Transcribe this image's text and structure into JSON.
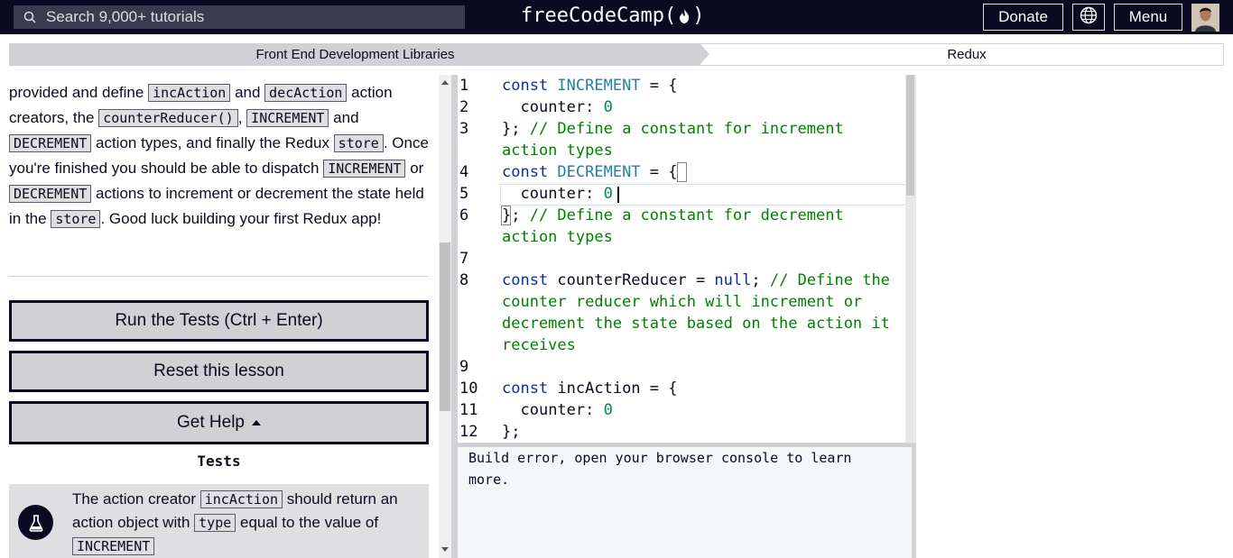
{
  "nav": {
    "search_placeholder": "Search 9,000+ tutorials",
    "logo_text_left": "freeCodeCamp(",
    "logo_text_right": ")",
    "donate_label": "Donate",
    "menu_label": "Menu"
  },
  "breadcrumb": {
    "superblock": "Front End Development Libraries",
    "block": "Redux"
  },
  "instructions": {
    "t1": "provided and define ",
    "c1": "incAction",
    "t2": " and ",
    "c2": "decAction",
    "t3": " action creators, the ",
    "c3": "counterReducer()",
    "t4": ", ",
    "c4": "INCREMENT",
    "t5": " and ",
    "c5": "DECREMENT",
    "t6": " action types, and finally the Redux ",
    "c6": "store",
    "t7": ". Once you're finished you should be able to dispatch ",
    "c7": "INCREMENT",
    "t8": " or ",
    "c8": "DECREMENT",
    "t9": " actions to increment or decrement the state held in the ",
    "c9": "store",
    "t10": ". Good luck building your first Redux app!"
  },
  "buttons": {
    "run": "Run the Tests (Ctrl + Enter)",
    "reset": "Reset this lesson",
    "help": "Get Help"
  },
  "tests": {
    "title": "Tests",
    "item1": {
      "t1": "The action creator ",
      "c1": "incAction",
      "t2": " should return an action object with ",
      "c2": "type",
      "t3": " equal to the value of ",
      "c3": "INCREMENT"
    }
  },
  "editor": {
    "lines": [
      {
        "n": "1",
        "parts": [
          [
            "kw",
            "const "
          ],
          [
            "const",
            "INCREMENT"
          ],
          [
            "plain",
            " = {"
          ]
        ]
      },
      {
        "n": "2",
        "parts": [
          [
            "plain",
            "  counter: "
          ],
          [
            "num",
            "0"
          ]
        ]
      },
      {
        "n": "3",
        "parts": [
          [
            "plain",
            "}; "
          ],
          [
            "cmt",
            "// Define a constant for increment action types"
          ]
        ]
      },
      {
        "n": "4",
        "parts": [
          [
            "kw",
            "const "
          ],
          [
            "const",
            "DECREMENT"
          ],
          [
            "plain",
            " = {"
          ]
        ]
      },
      {
        "n": "5",
        "parts": [
          [
            "plain",
            "  counter: "
          ],
          [
            "num",
            "0"
          ]
        ]
      },
      {
        "n": "6",
        "parts": [
          [
            "plain",
            "}; "
          ],
          [
            "cmt",
            "// Define a constant for decrement action types"
          ]
        ]
      },
      {
        "n": "7",
        "parts": [
          [
            "plain",
            ""
          ]
        ]
      },
      {
        "n": "8",
        "parts": [
          [
            "kw",
            "const "
          ],
          [
            "plain",
            "counterReducer = "
          ],
          [
            "kw",
            "null"
          ],
          [
            "plain",
            "; "
          ],
          [
            "cmt",
            "// Define the counter reducer which will increment or decrement the state based on the action it receives"
          ]
        ]
      },
      {
        "n": "9",
        "parts": [
          [
            "plain",
            ""
          ]
        ]
      },
      {
        "n": "10",
        "parts": [
          [
            "kw",
            "const "
          ],
          [
            "plain",
            "incAction = {"
          ]
        ]
      },
      {
        "n": "11",
        "parts": [
          [
            "plain",
            "  counter: "
          ],
          [
            "num",
            "0"
          ]
        ]
      },
      {
        "n": "12",
        "parts": [
          [
            "plain",
            "};"
          ]
        ]
      }
    ]
  },
  "output": {
    "text": "Build error, open your browser console to learn more."
  }
}
